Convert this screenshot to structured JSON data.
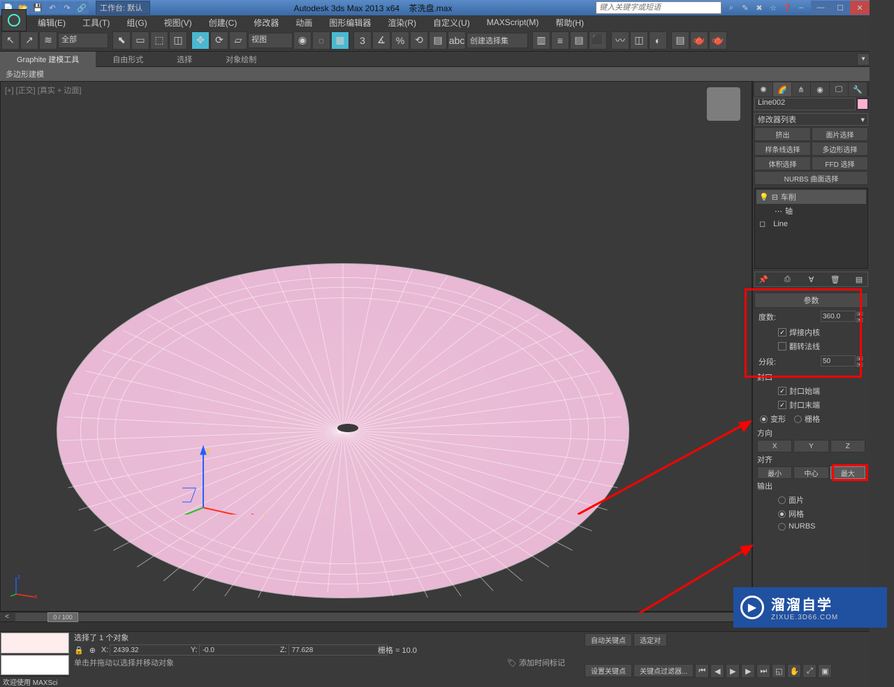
{
  "title_bar": {
    "app_name": "Autodesk 3ds Max  2013 x64",
    "file_name": "茶洗盘.max",
    "workspace_label": "工作台: 默认",
    "search_placeholder": "键入关键字或短语"
  },
  "menu": {
    "items": [
      "编辑(E)",
      "工具(T)",
      "组(G)",
      "视图(V)",
      "创建(C)",
      "修改器",
      "动画",
      "图形编辑器",
      "渲染(R)",
      "自定义(U)",
      "MAXScript(M)",
      "帮助(H)"
    ]
  },
  "toolbar": {
    "filter": "全部",
    "view_label": "视图",
    "selset_label": "创建选择集"
  },
  "ribbon": {
    "tabs": [
      "Graphite 建模工具",
      "自由形式",
      "选择",
      "对象绘制"
    ],
    "sub": "多边形建模"
  },
  "viewport": {
    "label": "[+] [正交] [真实 + 边面]"
  },
  "right_panel": {
    "object_name": "Line002",
    "modifier_list": "修改器列表",
    "preset_buttons": [
      "挤出",
      "面片选择",
      "样条线选择",
      "多边形选择",
      "体积选择",
      "FFD 选择"
    ],
    "nurbs_btn": "NURBS 曲面选择",
    "stack": {
      "lathe": "车削",
      "axis": "轴",
      "base": "Line"
    },
    "params_header": "参数",
    "degrees_label": "度数:",
    "degrees_value": "360.0",
    "weld_core": "焊接内核",
    "flip_normals": "翻转法线",
    "segments_label": "分段:",
    "segments_value": "50",
    "capping": "封口",
    "cap_start": "封口始端",
    "cap_end": "封口末端",
    "cap_morph": "变形",
    "cap_grid": "栅格",
    "direction": "方向",
    "dir_x": "X",
    "dir_y": "Y",
    "dir_z": "Z",
    "align": "对齐",
    "align_min": "最小",
    "align_center": "中心",
    "align_max": "最大",
    "output": "输出",
    "out_patch": "面片",
    "out_mesh": "网格",
    "out_nurbs": "NURBS"
  },
  "timeline": {
    "frame": "0 / 100"
  },
  "status": {
    "selection": "选择了 1 个对象",
    "hint": "单击并拖动以选择并移动对象",
    "x": "2439.32",
    "y": "-0.0",
    "z": "77.628",
    "grid": "栅格 = 10.0",
    "add_time_tag": "添加时间标记",
    "auto_key": "自动关键点",
    "selset2": "选定对",
    "set_key": "设置关键点",
    "key_filter": "关键点过滤器...",
    "welcome": "欢迎使用 MAXSci"
  },
  "watermark": {
    "cn": "溜溜自学",
    "en": "ZIXUE.3D66.COM"
  }
}
